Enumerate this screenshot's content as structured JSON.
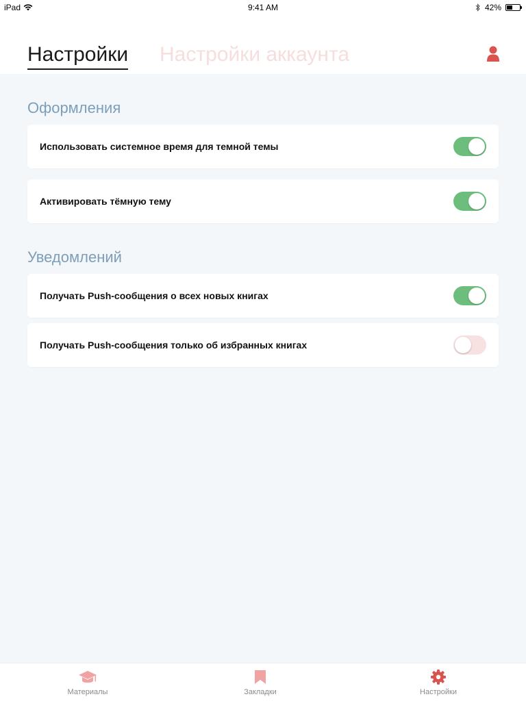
{
  "status_bar": {
    "device": "iPad",
    "time": "9:41 AM",
    "battery_percent": "42%",
    "battery_level": 0.42
  },
  "header": {
    "tabs": [
      {
        "label": "Настройки",
        "active": true
      },
      {
        "label": "Настройки аккаунта",
        "active": false
      }
    ],
    "profile_icon": "user-icon"
  },
  "sections": [
    {
      "title": "Оформления",
      "items": [
        {
          "label": "Использовать системное время для темной темы",
          "enabled": true
        },
        {
          "label": "Активировать тёмную тему",
          "enabled": true
        }
      ]
    },
    {
      "title": "Уведомлений",
      "items": [
        {
          "label": "Получать Push-сообщения о всех новых книгах",
          "enabled": true
        },
        {
          "label": "Получать Push-сообщения только об избранных книгах",
          "enabled": false
        }
      ]
    }
  ],
  "tab_bar": {
    "items": [
      {
        "label": "Материалы",
        "icon": "graduation-cap-icon",
        "active": false
      },
      {
        "label": "Закладки",
        "icon": "bookmark-icon",
        "active": false
      },
      {
        "label": "Настройки",
        "icon": "gear-icon",
        "active": true
      }
    ]
  },
  "colors": {
    "accent": "#d9534f",
    "accent_light": "#f0a3a3",
    "toggle_on": "#6dbe7d",
    "toggle_off": "#f7e1e1",
    "section_title": "#7c9eb9",
    "background": "#f4f7fa"
  }
}
